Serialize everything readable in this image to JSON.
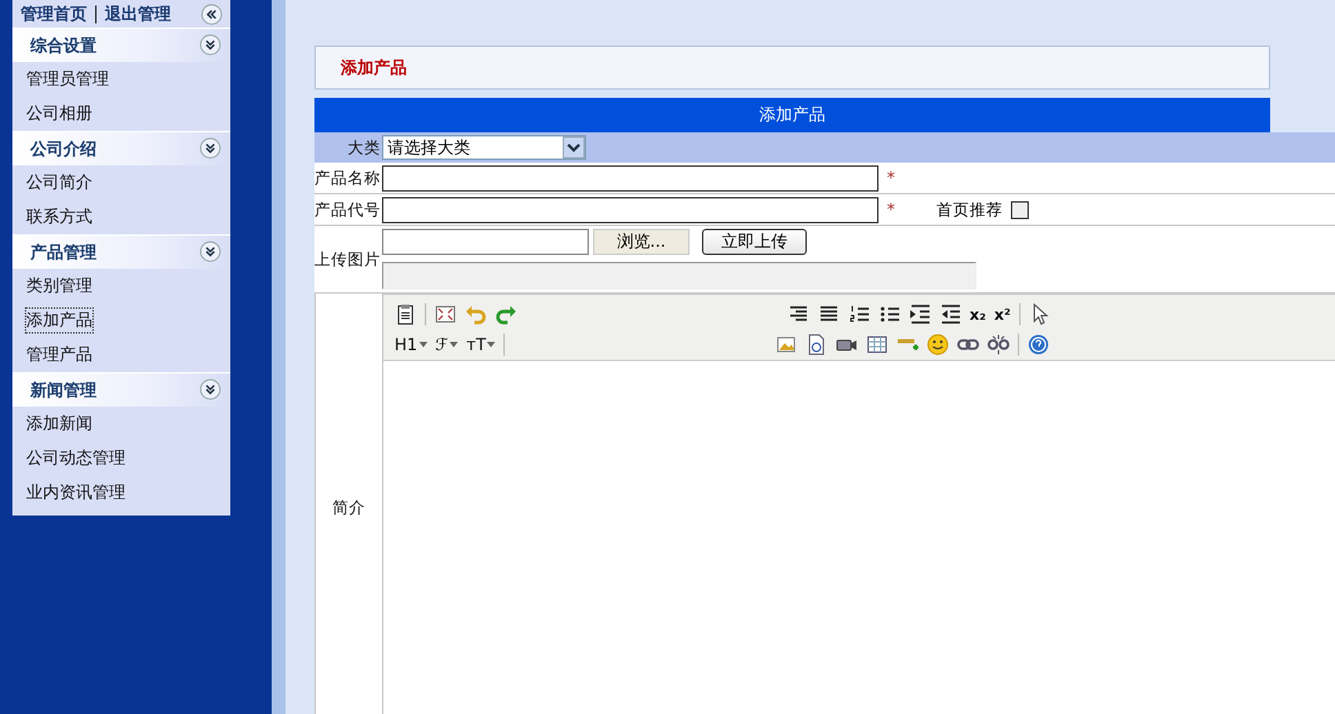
{
  "sidebar": {
    "top_links": [
      {
        "label": "管理首页"
      },
      {
        "label": "退出管理"
      }
    ],
    "groups": [
      {
        "title": "综合设置",
        "expanded": true,
        "items": [
          {
            "label": "管理员管理",
            "selected": false
          },
          {
            "label": "公司相册",
            "selected": false
          }
        ]
      },
      {
        "title": "公司介绍",
        "expanded": true,
        "items": [
          {
            "label": "公司简介",
            "selected": false
          },
          {
            "label": "联系方式",
            "selected": false
          }
        ]
      },
      {
        "title": "产品管理",
        "expanded": true,
        "items": [
          {
            "label": "类别管理",
            "selected": false
          },
          {
            "label": "添加产品",
            "selected": true
          },
          {
            "label": "管理产品",
            "selected": false
          }
        ]
      },
      {
        "title": "新闻管理",
        "expanded": true,
        "items": [
          {
            "label": "添加新闻",
            "selected": false
          },
          {
            "label": "公司动态管理",
            "selected": false
          },
          {
            "label": "业内资讯管理",
            "selected": false
          }
        ]
      }
    ]
  },
  "page_title": "添加产品",
  "form": {
    "header": "添加产品",
    "fields": [
      {
        "kind": "select",
        "label": "大类",
        "value": "请选择大类"
      },
      {
        "kind": "text",
        "label": "产品名称",
        "required_mark": "*"
      },
      {
        "kind": "text",
        "label": "产品代号",
        "required_mark": "*",
        "checkbox": {
          "label": "首页推荐",
          "checked": false
        }
      },
      {
        "kind": "upload",
        "label": "上传图片",
        "browse_button": "浏览...",
        "upload_button": "立即上传"
      },
      {
        "kind": "editor",
        "label": "简介",
        "toolbar_rows": [
          [
            {
              "kind": "paste"
            },
            {
              "kind": "sep"
            },
            {
              "kind": "fullscreen"
            },
            {
              "kind": "undo"
            },
            {
              "kind": "redo"
            },
            {
              "kind": "gap"
            },
            {
              "kind": "align-right"
            },
            {
              "kind": "justify"
            },
            {
              "kind": "ordered-list"
            },
            {
              "kind": "bullet-list"
            },
            {
              "kind": "indent"
            },
            {
              "kind": "outdent"
            },
            {
              "kind": "text",
              "label": "x₂"
            },
            {
              "kind": "text",
              "label": "x²"
            },
            {
              "kind": "sep"
            },
            {
              "kind": "pointer"
            }
          ],
          [
            {
              "kind": "menu",
              "label": "H1"
            },
            {
              "kind": "menu",
              "label": "ℱ"
            },
            {
              "kind": "menu",
              "label": "ᴛT"
            },
            {
              "kind": "sep"
            },
            {
              "kind": "gap"
            },
            {
              "kind": "image"
            },
            {
              "kind": "flash"
            },
            {
              "kind": "media"
            },
            {
              "kind": "table"
            },
            {
              "kind": "rule"
            },
            {
              "kind": "emoticon"
            },
            {
              "kind": "link"
            },
            {
              "kind": "unlink"
            },
            {
              "kind": "sep"
            },
            {
              "kind": "help"
            }
          ]
        ]
      }
    ]
  }
}
